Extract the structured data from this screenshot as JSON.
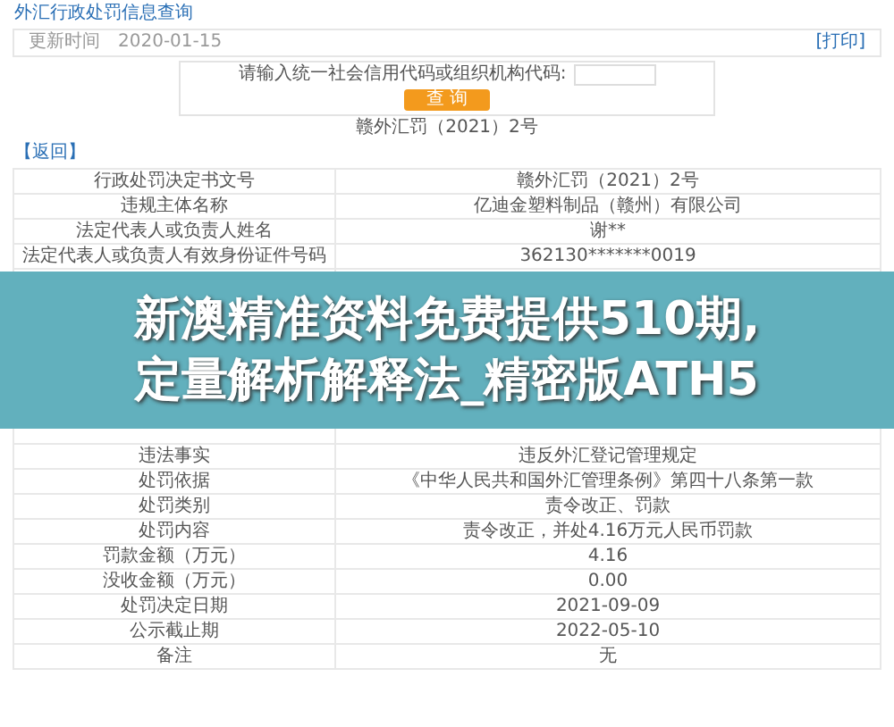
{
  "breadcrumb": "外汇行政处罚信息查询",
  "info_bar": {
    "label": "更新时间",
    "date": "2020-01-15",
    "print_link": "[打印]"
  },
  "search": {
    "label": "请输入统一社会信用代码或组织机构代码:",
    "button": "查 询"
  },
  "document_title": "赣外汇罚（2021）2号",
  "back_link": "【返回】",
  "rows": [
    {
      "label": "行政处罚决定书文号",
      "value": "赣外汇罚（2021）2号"
    },
    {
      "label": "违规主体名称",
      "value": "亿迪金塑料制品（赣州）有限公司"
    },
    {
      "label": "法定代表人或负责人姓名",
      "value": "谢**"
    },
    {
      "label": "法定代表人或负责人有效身份证件号码",
      "value": "362130*******0019"
    },
    {},
    {},
    {},
    {},
    {},
    {},
    {},
    {
      "label": "违法事实",
      "value": "违反外汇登记管理规定"
    },
    {
      "label": "处罚依据",
      "value": "《中华人民共和国外汇管理条例》第四十八条第一款"
    },
    {
      "label": "处罚类别",
      "value": "责令改正、罚款"
    },
    {
      "label": "处罚内容",
      "value": "责令改正，并处4.16万元人民币罚款"
    },
    {
      "label": "罚款金额（万元）",
      "value": "4.16"
    },
    {
      "label": "没收金额（万元）",
      "value": "0.00"
    },
    {
      "label": "处罚决定日期",
      "value": "2021-09-09"
    },
    {
      "label": "公示截止期",
      "value": "2022-05-10"
    },
    {
      "label": "备注",
      "value": "无"
    }
  ],
  "banner": {
    "lines": [
      "新澳精准资料免费提供510期,",
      "定量解析解释法_精密版ATH5"
    ]
  }
}
